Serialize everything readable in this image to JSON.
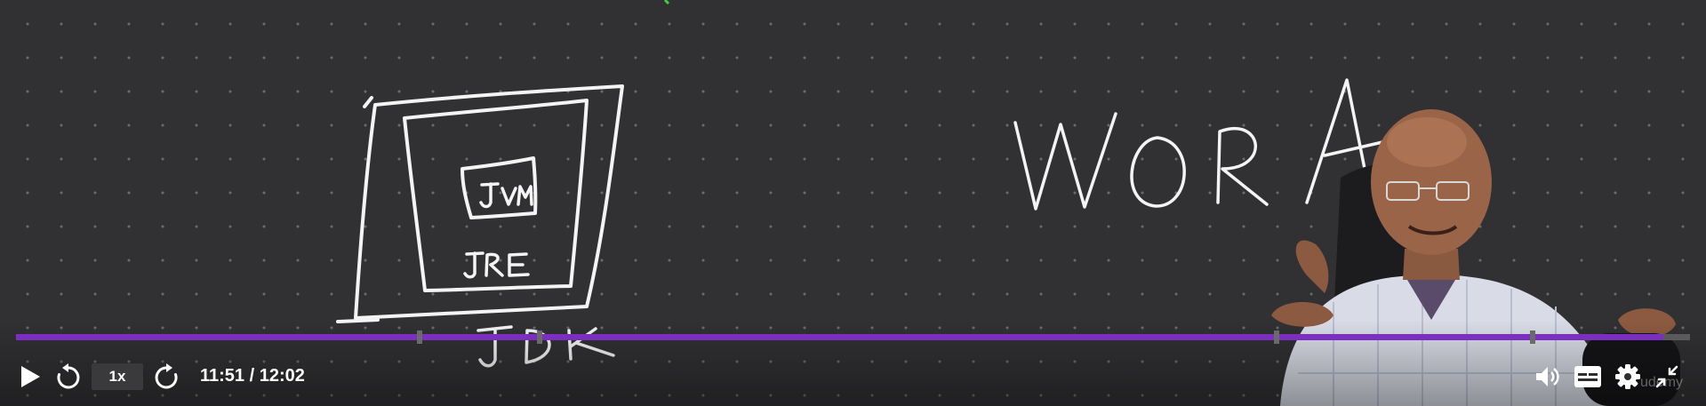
{
  "player": {
    "playback_speed": "1x",
    "current_time": "11:51",
    "duration": "12:02",
    "time_text": "11:51 / 12:02",
    "progress_fraction": 0.984,
    "chapter_markers_fraction": [
      0.241,
      0.313,
      0.753,
      0.906
    ],
    "accent_color": "#7b2fbf"
  },
  "whiteboard": {
    "outer_box_label": "JDK",
    "middle_box_label": "JRE",
    "inner_box_label": "JVM",
    "headline": "WORA"
  },
  "watermark": "udemy",
  "icons": {
    "play": "play-icon",
    "rewind": "rewind-icon",
    "forward": "forward-icon",
    "volume": "volume-icon",
    "captions": "captions-icon",
    "settings": "gear-icon",
    "fullscreen": "exit-fullscreen-icon"
  }
}
